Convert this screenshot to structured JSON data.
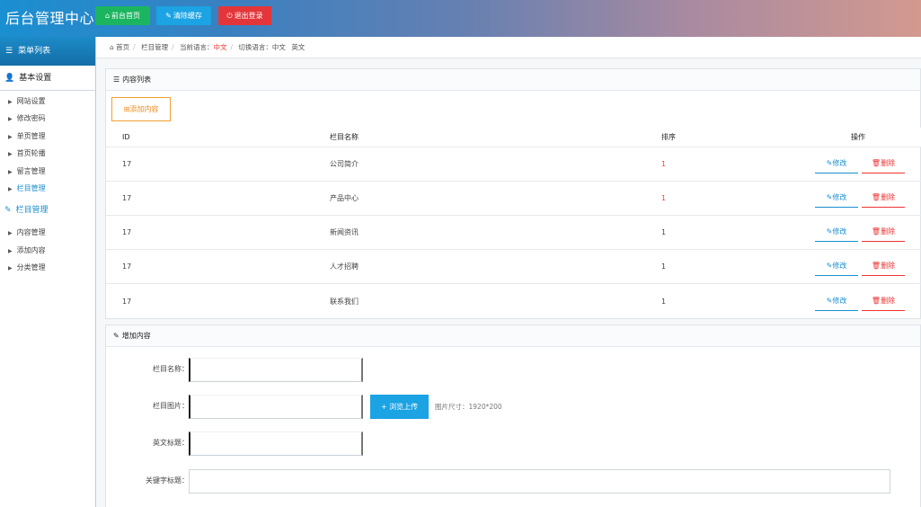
{
  "header": {
    "brand": "后台管理中心",
    "buttons": [
      {
        "label": "前台首页",
        "icon": "home-icon"
      },
      {
        "label": "清除缓存",
        "icon": "wrench-icon"
      },
      {
        "label": "退出登录",
        "icon": "power-icon"
      }
    ]
  },
  "sidebar": {
    "title": "菜单列表",
    "groups": [
      {
        "label": "基本设置",
        "items": [
          "网站设置",
          "修改密码",
          "单页管理",
          "首页轮播",
          "留言管理",
          "栏目管理"
        ],
        "active": 5
      },
      {
        "label": "栏目管理",
        "items": [
          "内容管理",
          "添加内容",
          "分类管理"
        ]
      }
    ]
  },
  "breadcrumb": {
    "home": "首页",
    "section": "栏目管理",
    "current_label": "当前语言：",
    "current_value": "中文",
    "switch_label": "切换语言：",
    "switch_zh": "中文",
    "switch_en": "英文"
  },
  "list_panel": {
    "title": "内容列表",
    "add_label": "添加内容",
    "columns": {
      "id": "ID",
      "name": "栏目名称",
      "sort": "排序",
      "ops": "操作"
    },
    "rows": [
      {
        "id": "17",
        "name": "公司简介",
        "sort": "1"
      },
      {
        "id": "17",
        "name": "产品中心",
        "sort": "1"
      },
      {
        "id": "17",
        "name": "新闻资讯",
        "sort": "1"
      },
      {
        "id": "17",
        "name": "人才招聘",
        "sort": "1"
      },
      {
        "id": "17",
        "name": "联系我们",
        "sort": "1"
      }
    ],
    "edit_label": "修改",
    "delete_label": "删除"
  },
  "form_panel": {
    "title": "增加内容",
    "fields": {
      "name_label": "栏目名称：",
      "image_label": "栏目图片：",
      "upload_label": "浏览上传",
      "image_hint": "图片尺寸：1920*200",
      "en_title_label": "英文标题：",
      "keyword_label": "关键字标题："
    }
  },
  "colors": {
    "accent": "#1a8fd1",
    "green": "#1bb55f",
    "red": "#e3363a",
    "orange": "#f08c1a"
  }
}
